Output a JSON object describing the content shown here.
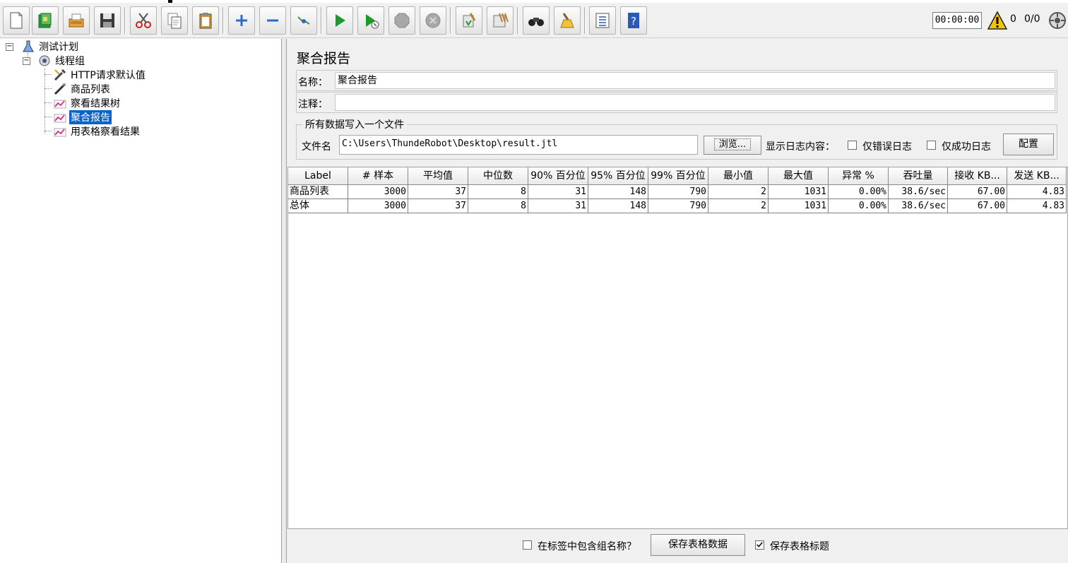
{
  "toolbar": {
    "buttons": [
      "new-icon",
      "templates-icon",
      "open-icon",
      "save-icon",
      "cut-icon",
      "copy-icon",
      "paste-icon",
      "expand-icon",
      "collapse-icon",
      "toggle-icon",
      "start-icon",
      "start-no-pause-icon",
      "stop-icon",
      "shutdown-icon",
      "clear-icon",
      "clear-all-icon",
      "search-icon",
      "reset-search-icon",
      "function-helper-icon",
      "help-icon"
    ],
    "timer": "00:00:00",
    "warning_count": "0",
    "thread_count": "0/0"
  },
  "tree": {
    "root": "测试计划",
    "thread_group": "线程组",
    "items": [
      {
        "label": "HTTP请求默认值",
        "icon": "wrench-icon"
      },
      {
        "label": "商品列表",
        "icon": "sampler-icon"
      },
      {
        "label": "察看结果树",
        "icon": "listener-icon"
      },
      {
        "label": "聚合报告",
        "icon": "listener-icon",
        "selected": true
      },
      {
        "label": "用表格察看结果",
        "icon": "listener-icon"
      }
    ]
  },
  "panel": {
    "title": "聚合报告",
    "name_label": "名称：",
    "name_value": "聚合报告",
    "comment_label": "注释：",
    "comment_value": "",
    "file_group_title": "所有数据写入一个文件",
    "file_label": "文件名",
    "file_value": "C:\\Users\\ThundeRobot\\Desktop\\result.jtl",
    "browse_label": "浏览...",
    "log_label": "显示日志内容：",
    "errors_only_label": "仅错误日志",
    "success_only_label": "仅成功日志",
    "configure_label": "配置"
  },
  "table": {
    "columns": [
      "Label",
      "# 样本",
      "平均值",
      "中位数",
      "90% 百分位",
      "95% 百分位",
      "99% 百分位",
      "最小值",
      "最大值",
      "异常 %",
      "吞吐量",
      "接收 KB...",
      "发送 KB..."
    ],
    "rows": [
      [
        "商品列表",
        "3000",
        "37",
        "8",
        "31",
        "148",
        "790",
        "2",
        "1031",
        "0.00%",
        "38.6/sec",
        "67.00",
        "4.83"
      ],
      [
        "总体",
        "3000",
        "37",
        "8",
        "31",
        "148",
        "790",
        "2",
        "1031",
        "0.00%",
        "38.6/sec",
        "67.00",
        "4.83"
      ]
    ]
  },
  "bottom": {
    "include_group_label": "在标签中包含组名称？",
    "save_table_label": "保存表格数据",
    "save_header_label": "保存表格标题",
    "save_header_checked": true,
    "include_group_checked": false
  }
}
